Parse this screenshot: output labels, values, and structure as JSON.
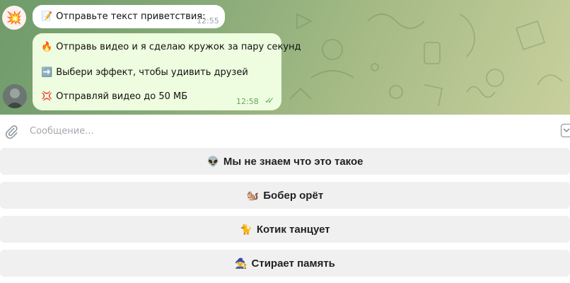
{
  "chat": {
    "messages": [
      {
        "sender_avatar_icon": "explosion-avatar-icon",
        "lines": [
          {
            "emoji": "📝",
            "text": "Отправьте текст приветствия:"
          }
        ],
        "time": "12:55"
      },
      {
        "sender_avatar_icon": "photo-avatar",
        "lines": [
          {
            "emoji": "🔥",
            "text": "Отправь видео и я сделаю кружок за пару секунд"
          },
          {
            "emoji": "➡️",
            "text": "Выбери эффект, чтобы удивить друзей"
          },
          {
            "emoji": "💢",
            "text": "Отправляй видео до 50 МБ"
          }
        ],
        "time": "12:58",
        "read_checks": "✓✓"
      }
    ],
    "avatar_emoji": "💥"
  },
  "input": {
    "placeholder": "Сообщение..."
  },
  "keyboard": {
    "buttons": [
      {
        "emoji": "👽",
        "label": "Мы не знаем что это такое"
      },
      {
        "emoji": "🐿️",
        "label": "Бобер орёт"
      },
      {
        "emoji": "🐈",
        "label": "Котик танцует"
      },
      {
        "emoji": "🧙",
        "label": "Стирает память"
      }
    ]
  },
  "colors": {
    "incoming_bubble": "#ffffff",
    "outgoing_bubble": "#eefcdf",
    "keyboard_button": "#f0f0f0",
    "chat_bg_from": "#6f9b6a",
    "chat_bg_to": "#c8d09e"
  }
}
